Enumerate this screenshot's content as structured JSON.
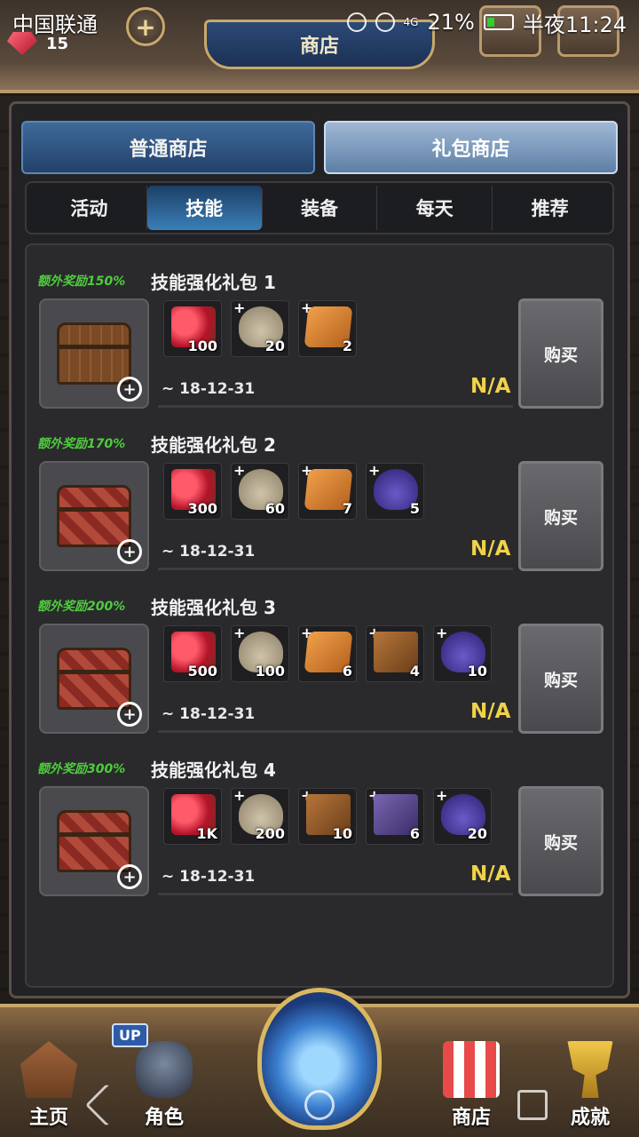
{
  "status_bar": {
    "carrier": "中国联通",
    "battery": "21%",
    "time": "半夜11:24",
    "network": "4G"
  },
  "header": {
    "title": "商店",
    "gem_count": "15",
    "add_label": "+"
  },
  "store_tabs": [
    {
      "label": "普通商店",
      "active": false
    },
    {
      "label": "礼包商店",
      "active": true
    }
  ],
  "category_tabs": [
    {
      "label": "活动",
      "active": false
    },
    {
      "label": "技能",
      "active": true
    },
    {
      "label": "装备",
      "active": false
    },
    {
      "label": "每天",
      "active": false
    },
    {
      "label": "推荐",
      "active": false
    }
  ],
  "packs": [
    {
      "bonus": "额外奖励150%",
      "title": "技能强化礼包 1",
      "date": "~ 18-12-31",
      "price": "N/A",
      "buy_label": "购买",
      "items": [
        {
          "icon": "gem-chest-icon",
          "qty": "100"
        },
        {
          "icon": "gem-bag-icon",
          "qty": "20"
        },
        {
          "icon": "skill-scroll-icon",
          "qty": "2"
        }
      ]
    },
    {
      "bonus": "额外奖励170%",
      "title": "技能强化礼包 2",
      "date": "~ 18-12-31",
      "price": "N/A",
      "buy_label": "购买",
      "items": [
        {
          "icon": "gem-chest-icon",
          "qty": "300"
        },
        {
          "icon": "gem-bag-icon",
          "qty": "60"
        },
        {
          "icon": "skill-scroll-icon",
          "qty": "7"
        },
        {
          "icon": "purple-pouch-icon",
          "qty": "5"
        }
      ]
    },
    {
      "bonus": "额外奖励200%",
      "title": "技能强化礼包 3",
      "date": "~ 18-12-31",
      "price": "N/A",
      "buy_label": "购买",
      "items": [
        {
          "icon": "gem-chest-icon",
          "qty": "500"
        },
        {
          "icon": "gem-bag-icon",
          "qty": "100"
        },
        {
          "icon": "skill-scroll-icon",
          "qty": "6"
        },
        {
          "icon": "rolled-scroll-icon",
          "qty": "4"
        },
        {
          "icon": "purple-pouch-icon",
          "qty": "10"
        }
      ]
    },
    {
      "bonus": "额外奖励300%",
      "title": "技能强化礼包 4",
      "date": "~ 18-12-31",
      "price": "N/A",
      "buy_label": "购买",
      "items": [
        {
          "icon": "gem-chest-icon",
          "qty": "1K"
        },
        {
          "icon": "gem-bag-icon",
          "qty": "200"
        },
        {
          "icon": "rolled-scroll-icon",
          "qty": "10"
        },
        {
          "icon": "purple-scroll-icon",
          "qty": "6"
        },
        {
          "icon": "purple-pouch-icon",
          "qty": "20"
        }
      ]
    }
  ],
  "bottom_nav": {
    "home": "主页",
    "hero": "角色",
    "shop": "商店",
    "achievements": "成就",
    "up_badge": "UP"
  },
  "colors": {
    "bonus_green": "#4ecc3c",
    "price_yellow": "#f0d24a",
    "active_tab_blue": "#3a7fb8"
  }
}
